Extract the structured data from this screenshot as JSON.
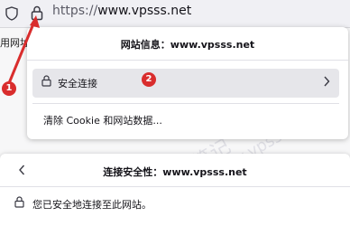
{
  "urlbar": {
    "protocol": "https://",
    "domain": "www.vpsss.net"
  },
  "page": {
    "fragment": "用网址"
  },
  "site_info_panel": {
    "title": "网站信息：www.vpsss.net",
    "secure_connection": "安全连接",
    "clear_data": "清除 Cookie 和网站数据..."
  },
  "security_panel": {
    "title": "连接安全性：www.vpsss.net",
    "secure_text": "您已安全地连接至此网站。"
  },
  "annotations": {
    "step1": "1",
    "step2": "2",
    "arrow_color": "#d92d2d",
    "badge_color": "#d92d2d"
  },
  "watermark": {
    "text1": "魏艾斯笔记",
    "text2": "www.vpsss.net"
  }
}
